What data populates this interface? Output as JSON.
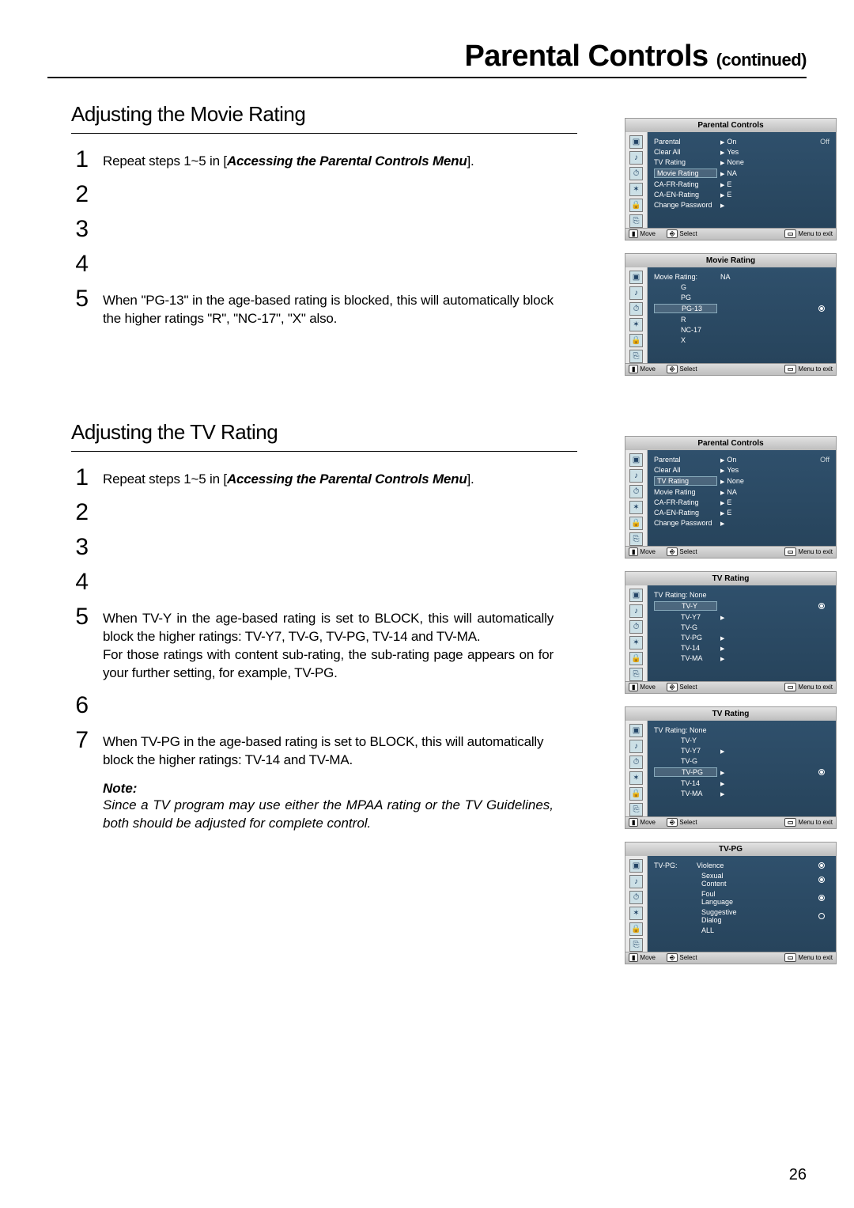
{
  "header": {
    "title": "Parental Controls",
    "cont": "(continued)"
  },
  "page_number": "26",
  "sections": {
    "movie": {
      "heading": "Adjusting the Movie Rating",
      "steps": {
        "s1a": "Repeat steps 1~5 in [",
        "s1b": "Accessing the Parental Controls Menu",
        "s1c": "].",
        "s5": "When \"PG-13\" in the age-based rating is blocked, this will automatically block the higher ratings \"R\", \"NC-17\", \"X\" also."
      }
    },
    "tv": {
      "heading": "Adjusting the TV Rating",
      "steps": {
        "s1a": "Repeat steps 1~5 in [",
        "s1b": "Accessing the Parental Controls Menu",
        "s1c": "].",
        "s5a": "When TV-Y in the age-based rating is set to BLOCK, this will automatically block the higher ratings: TV-Y7, TV-G, TV-PG, TV-14 and TV-MA.",
        "s5b": "For those ratings with content sub-rating, the sub-rating page appears on for your further setting, for example, TV-PG.",
        "s7": "When TV-PG in the age-based rating is set to BLOCK, this will automatically block the higher ratings: TV-14 and TV-MA."
      },
      "note_label": "Note:",
      "note_text": "Since a TV program may use either the MPAA rating or the TV Guidelines, both should be adjusted for complete control."
    }
  },
  "osd": {
    "foot_move": "Move",
    "foot_select": "Select",
    "foot_menu": "Menu to exit",
    "pc_title": "Parental Controls",
    "pc_rows": [
      {
        "label": "Parental",
        "val": "On",
        "extra": "Off"
      },
      {
        "label": "Clear All",
        "val": "Yes"
      },
      {
        "label": "TV Rating",
        "val": "None"
      },
      {
        "label": "Movie Rating",
        "val": "NA",
        "selected": true
      },
      {
        "label": "CA-FR-Rating",
        "val": "E"
      },
      {
        "label": "CA-EN-Rating",
        "val": "E"
      },
      {
        "label": "Change Password",
        "val": ""
      }
    ],
    "movie_title": "Movie Rating",
    "movie_label": "Movie Rating:",
    "movie_vals": [
      "NA",
      "G",
      "PG",
      "PG-13",
      "R",
      "NC-17",
      "X"
    ],
    "movie_selected": "PG-13",
    "pc2_rows": [
      {
        "label": "Parental",
        "val": "On",
        "extra": "Off"
      },
      {
        "label": "Clear All",
        "val": "Yes"
      },
      {
        "label": "TV Rating",
        "val": "None",
        "selected": true
      },
      {
        "label": "Movie Rating",
        "val": "NA"
      },
      {
        "label": "CA-FR-Rating",
        "val": "E"
      },
      {
        "label": "CA-EN-Rating",
        "val": "E"
      },
      {
        "label": "Change Password",
        "val": ""
      }
    ],
    "tvr_title": "TV Rating",
    "tvr_label": "TV Rating: None",
    "tvr_vals": [
      "TV-Y",
      "TV-Y7",
      "TV-G",
      "TV-PG",
      "TV-14",
      "TV-MA"
    ],
    "tvr_selected": "TV-Y",
    "tvr2_selected": "TV-PG",
    "tvpg_title": "TV-PG",
    "tvpg_label": "TV-PG:",
    "tvpg_rows": [
      "Violence",
      "Sexual Content",
      "Foul Language",
      "Suggestive Dialog",
      "ALL"
    ]
  }
}
